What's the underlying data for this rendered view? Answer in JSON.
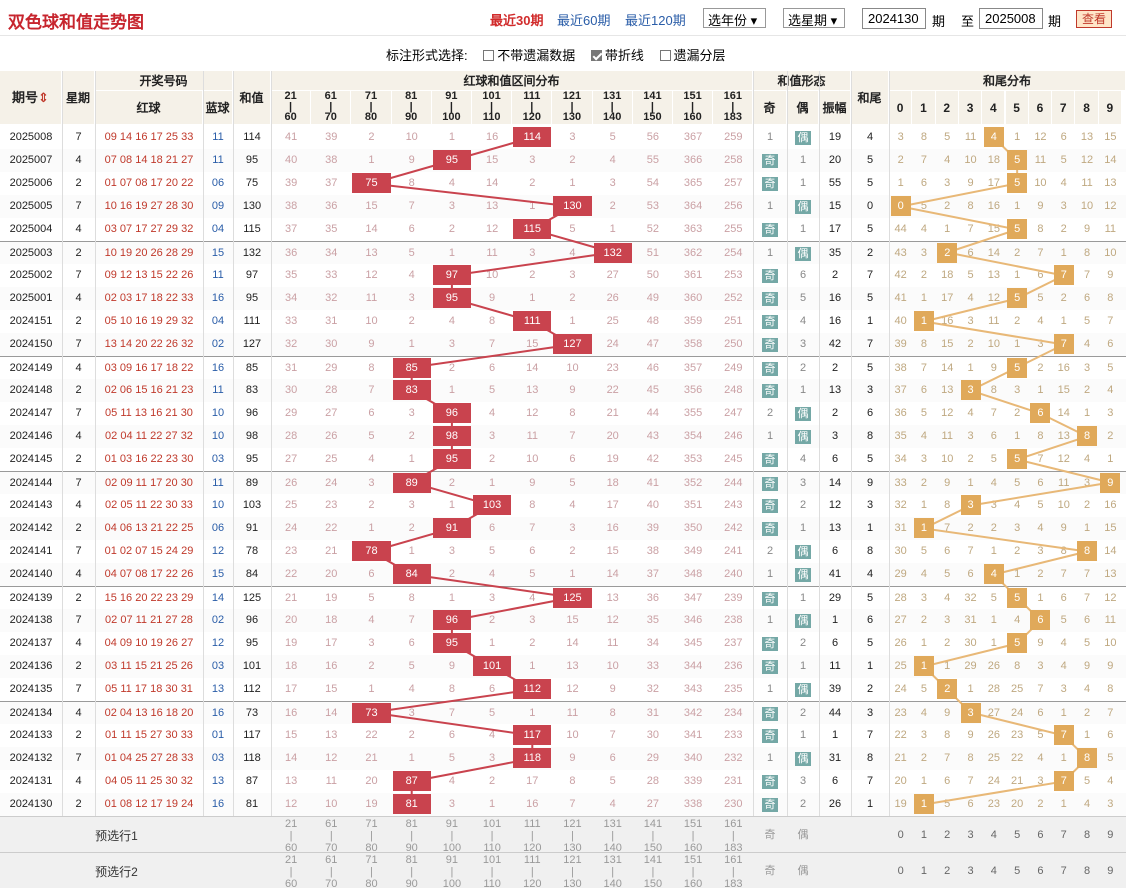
{
  "page": {
    "title": "双色球和值走势图",
    "recent": [
      "最近30期",
      "最近60期",
      "最近120期"
    ],
    "select_year": "选年份",
    "select_period": "选星期",
    "from_value": "2024130",
    "to_value": "2025008",
    "qi": "期",
    "zhi": "至",
    "query_button": "查看",
    "options_label": "标注形式选择:",
    "options": [
      {
        "label": "不带遗漏数据",
        "checked": false
      },
      {
        "label": "带折线",
        "checked": true
      },
      {
        "label": "遗漏分层",
        "checked": false
      }
    ]
  },
  "headers": {
    "period": "期号",
    "weekday": "星期",
    "draw": "开奖号码",
    "red": "红球",
    "blue": "蓝球",
    "sum": "和值",
    "dist": "红球和值区间分布",
    "form": "和值形态",
    "tail": "和尾",
    "tail_dist": "和尾分布",
    "odd": "奇",
    "even": "偶",
    "amp": "振幅",
    "ranges": [
      [
        "21",
        "60"
      ],
      [
        "61",
        "70"
      ],
      [
        "71",
        "80"
      ],
      [
        "81",
        "90"
      ],
      [
        "91",
        "100"
      ],
      [
        "101",
        "110"
      ],
      [
        "111",
        "120"
      ],
      [
        "121",
        "130"
      ],
      [
        "131",
        "140"
      ],
      [
        "141",
        "150"
      ],
      [
        "151",
        "160"
      ],
      [
        "161",
        "183"
      ]
    ],
    "tails": [
      "0",
      "1",
      "2",
      "3",
      "4",
      "5",
      "6",
      "7",
      "8",
      "9"
    ]
  },
  "rows": [
    {
      "period": "2025008",
      "week": "7",
      "red": "09 14 16 17 25 33",
      "blue": "11",
      "sum": "114",
      "dist": [
        "41",
        "39",
        "2",
        "10",
        "1",
        "16",
        "114",
        "3",
        "5",
        "56",
        "367",
        "259"
      ],
      "odd": "1",
      "even": "偶",
      "amp": "19",
      "tail": "4",
      "tails": [
        "3",
        "8",
        "5",
        "11",
        "4",
        "1",
        "12",
        "6",
        "13",
        "15"
      ]
    },
    {
      "period": "2025007",
      "week": "4",
      "red": "07 08 14 18 21 27",
      "blue": "11",
      "sum": "95",
      "dist": [
        "40",
        "38",
        "1",
        "9",
        "95",
        "15",
        "3",
        "2",
        "4",
        "55",
        "366",
        "258"
      ],
      "odd": "奇",
      "even": "1",
      "amp": "20",
      "tail": "5",
      "tails": [
        "2",
        "7",
        "4",
        "10",
        "18",
        "5",
        "11",
        "5",
        "12",
        "14"
      ]
    },
    {
      "period": "2025006",
      "week": "2",
      "red": "01 07 08 17 20 22",
      "blue": "06",
      "sum": "75",
      "dist": [
        "39",
        "37",
        "75",
        "8",
        "4",
        "14",
        "2",
        "1",
        "3",
        "54",
        "365",
        "257"
      ],
      "odd": "奇",
      "even": "1",
      "amp": "55",
      "tail": "5",
      "tails": [
        "1",
        "6",
        "3",
        "9",
        "17",
        "5",
        "10",
        "4",
        "11",
        "13"
      ]
    },
    {
      "period": "2025005",
      "week": "7",
      "red": "10 16 19 27 28 30",
      "blue": "09",
      "sum": "130",
      "dist": [
        "38",
        "36",
        "15",
        "7",
        "3",
        "13",
        "1",
        "130",
        "2",
        "53",
        "364",
        "256"
      ],
      "odd": "1",
      "even": "偶",
      "amp": "15",
      "tail": "0",
      "tails": [
        "0",
        "5",
        "2",
        "8",
        "16",
        "1",
        "9",
        "3",
        "10",
        "12"
      ]
    },
    {
      "period": "2025004",
      "week": "4",
      "red": "03 07 17 27 29 32",
      "blue": "04",
      "sum": "115",
      "dist": [
        "37",
        "35",
        "14",
        "6",
        "2",
        "12",
        "115",
        "5",
        "1",
        "52",
        "363",
        "255"
      ],
      "odd": "奇",
      "even": "1",
      "amp": "17",
      "tail": "5",
      "tails": [
        "44",
        "4",
        "1",
        "7",
        "15",
        "5",
        "8",
        "2",
        "9",
        "11"
      ]
    },
    {
      "period": "2025003",
      "week": "2",
      "red": "10 19 20 26 28 29",
      "blue": "15",
      "sum": "132",
      "dist": [
        "36",
        "34",
        "13",
        "5",
        "1",
        "11",
        "3",
        "4",
        "132",
        "51",
        "362",
        "254"
      ],
      "odd": "1",
      "even": "偶",
      "amp": "35",
      "tail": "2",
      "tails": [
        "43",
        "3",
        "2",
        "6",
        "14",
        "2",
        "7",
        "1",
        "8",
        "10"
      ]
    },
    {
      "period": "2025002",
      "week": "7",
      "red": "09 12 13 15 22 26",
      "blue": "11",
      "sum": "97",
      "dist": [
        "35",
        "33",
        "12",
        "4",
        "97",
        "10",
        "2",
        "3",
        "27",
        "50",
        "361",
        "253"
      ],
      "odd": "奇",
      "even": "6",
      "amp": "2",
      "tail": "7",
      "tails": [
        "42",
        "2",
        "18",
        "5",
        "13",
        "1",
        "6",
        "7",
        "7",
        "9"
      ]
    },
    {
      "period": "2025001",
      "week": "4",
      "red": "02 03 17 18 22 33",
      "blue": "16",
      "sum": "95",
      "dist": [
        "34",
        "32",
        "11",
        "3",
        "95",
        "9",
        "1",
        "2",
        "26",
        "49",
        "360",
        "252"
      ],
      "odd": "奇",
      "even": "5",
      "amp": "16",
      "tail": "5",
      "tails": [
        "41",
        "1",
        "17",
        "4",
        "12",
        "5",
        "5",
        "2",
        "6",
        "8"
      ]
    },
    {
      "period": "2024151",
      "week": "2",
      "red": "05 10 16 19 29 32",
      "blue": "04",
      "sum": "111",
      "dist": [
        "33",
        "31",
        "10",
        "2",
        "4",
        "8",
        "111",
        "1",
        "25",
        "48",
        "359",
        "251"
      ],
      "odd": "奇",
      "even": "4",
      "amp": "16",
      "tail": "1",
      "tails": [
        "40",
        "1",
        "16",
        "3",
        "11",
        "2",
        "4",
        "1",
        "5",
        "7"
      ]
    },
    {
      "period": "2024150",
      "week": "7",
      "red": "13 14 20 22 26 32",
      "blue": "02",
      "sum": "127",
      "dist": [
        "32",
        "30",
        "9",
        "1",
        "3",
        "7",
        "15",
        "127",
        "24",
        "47",
        "358",
        "250"
      ],
      "odd": "奇",
      "even": "3",
      "amp": "42",
      "tail": "7",
      "tails": [
        "39",
        "8",
        "15",
        "2",
        "10",
        "1",
        "3",
        "7",
        "4",
        "6"
      ]
    },
    {
      "period": "2024149",
      "week": "4",
      "red": "03 09 16 17 18 22",
      "blue": "16",
      "sum": "85",
      "dist": [
        "31",
        "29",
        "8",
        "85",
        "2",
        "6",
        "14",
        "10",
        "23",
        "46",
        "357",
        "249"
      ],
      "odd": "奇",
      "even": "2",
      "amp": "2",
      "tail": "5",
      "tails": [
        "38",
        "7",
        "14",
        "1",
        "9",
        "5",
        "2",
        "16",
        "3",
        "5"
      ]
    },
    {
      "period": "2024148",
      "week": "2",
      "red": "02 06 15 16 21 23",
      "blue": "11",
      "sum": "83",
      "dist": [
        "30",
        "28",
        "7",
        "83",
        "1",
        "5",
        "13",
        "9",
        "22",
        "45",
        "356",
        "248"
      ],
      "odd": "奇",
      "even": "1",
      "amp": "13",
      "tail": "3",
      "tails": [
        "37",
        "6",
        "13",
        "3",
        "8",
        "3",
        "1",
        "15",
        "2",
        "4"
      ]
    },
    {
      "period": "2024147",
      "week": "7",
      "red": "05 11 13 16 21 30",
      "blue": "10",
      "sum": "96",
      "dist": [
        "29",
        "27",
        "6",
        "3",
        "96",
        "4",
        "12",
        "8",
        "21",
        "44",
        "355",
        "247"
      ],
      "odd": "2",
      "even": "偶",
      "amp": "2",
      "tail": "6",
      "tails": [
        "36",
        "5",
        "12",
        "4",
        "7",
        "2",
        "6",
        "14",
        "1",
        "3"
      ]
    },
    {
      "period": "2024146",
      "week": "4",
      "red": "02 04 11 22 27 32",
      "blue": "10",
      "sum": "98",
      "dist": [
        "28",
        "26",
        "5",
        "2",
        "98",
        "3",
        "11",
        "7",
        "20",
        "43",
        "354",
        "246"
      ],
      "odd": "1",
      "even": "偶",
      "amp": "3",
      "tail": "8",
      "tails": [
        "35",
        "4",
        "11",
        "3",
        "6",
        "1",
        "8",
        "13",
        "8",
        "2"
      ]
    },
    {
      "period": "2024145",
      "week": "2",
      "red": "01 03 16 22 23 30",
      "blue": "03",
      "sum": "95",
      "dist": [
        "27",
        "25",
        "4",
        "1",
        "95",
        "2",
        "10",
        "6",
        "19",
        "42",
        "353",
        "245"
      ],
      "odd": "奇",
      "even": "4",
      "amp": "6",
      "tail": "5",
      "tails": [
        "34",
        "3",
        "10",
        "2",
        "5",
        "5",
        "7",
        "12",
        "4",
        "1"
      ]
    },
    {
      "period": "2024144",
      "week": "7",
      "red": "02 09 11 17 20 30",
      "blue": "11",
      "sum": "89",
      "dist": [
        "26",
        "24",
        "3",
        "89",
        "2",
        "1",
        "9",
        "5",
        "18",
        "41",
        "352",
        "244"
      ],
      "odd": "奇",
      "even": "3",
      "amp": "14",
      "tail": "9",
      "tails": [
        "33",
        "2",
        "9",
        "1",
        "4",
        "5",
        "6",
        "11",
        "3",
        "9"
      ]
    },
    {
      "period": "2024143",
      "week": "4",
      "red": "02 05 11 22 30 33",
      "blue": "10",
      "sum": "103",
      "dist": [
        "25",
        "23",
        "2",
        "3",
        "1",
        "103",
        "8",
        "4",
        "17",
        "40",
        "351",
        "243"
      ],
      "odd": "奇",
      "even": "2",
      "amp": "12",
      "tail": "3",
      "tails": [
        "32",
        "1",
        "8",
        "3",
        "3",
        "4",
        "5",
        "10",
        "2",
        "16"
      ]
    },
    {
      "period": "2024142",
      "week": "2",
      "red": "04 06 13 21 22 25",
      "blue": "06",
      "sum": "91",
      "dist": [
        "24",
        "22",
        "1",
        "2",
        "91",
        "6",
        "7",
        "3",
        "16",
        "39",
        "350",
        "242"
      ],
      "odd": "奇",
      "even": "1",
      "amp": "13",
      "tail": "1",
      "tails": [
        "31",
        "1",
        "7",
        "2",
        "2",
        "3",
        "4",
        "9",
        "1",
        "15"
      ]
    },
    {
      "period": "2024141",
      "week": "7",
      "red": "01 02 07 15 24 29",
      "blue": "12",
      "sum": "78",
      "dist": [
        "23",
        "21",
        "78",
        "1",
        "3",
        "5",
        "6",
        "2",
        "15",
        "38",
        "349",
        "241"
      ],
      "odd": "2",
      "even": "偶",
      "amp": "6",
      "tail": "8",
      "tails": [
        "30",
        "5",
        "6",
        "7",
        "1",
        "2",
        "3",
        "8",
        "8",
        "14"
      ]
    },
    {
      "period": "2024140",
      "week": "4",
      "red": "04 07 08 17 22 26",
      "blue": "15",
      "sum": "84",
      "dist": [
        "22",
        "20",
        "6",
        "84",
        "2",
        "4",
        "5",
        "1",
        "14",
        "37",
        "348",
        "240"
      ],
      "odd": "1",
      "even": "偶",
      "amp": "41",
      "tail": "4",
      "tails": [
        "29",
        "4",
        "5",
        "6",
        "4",
        "1",
        "2",
        "7",
        "7",
        "13"
      ]
    },
    {
      "period": "2024139",
      "week": "2",
      "red": "15 16 20 22 23 29",
      "blue": "14",
      "sum": "125",
      "dist": [
        "21",
        "19",
        "5",
        "8",
        "1",
        "3",
        "4",
        "125",
        "13",
        "36",
        "347",
        "239"
      ],
      "odd": "奇",
      "even": "1",
      "amp": "29",
      "tail": "5",
      "tails": [
        "28",
        "3",
        "4",
        "32",
        "5",
        "5",
        "1",
        "6",
        "7",
        "12"
      ]
    },
    {
      "period": "2024138",
      "week": "7",
      "red": "02 07 11 21 27 28",
      "blue": "02",
      "sum": "96",
      "dist": [
        "20",
        "18",
        "4",
        "7",
        "96",
        "2",
        "3",
        "15",
        "12",
        "35",
        "346",
        "238"
      ],
      "odd": "1",
      "even": "偶",
      "amp": "1",
      "tail": "6",
      "tails": [
        "27",
        "2",
        "3",
        "31",
        "1",
        "4",
        "6",
        "5",
        "6",
        "11"
      ]
    },
    {
      "period": "2024137",
      "week": "4",
      "red": "04 09 10 19 26 27",
      "blue": "12",
      "sum": "95",
      "dist": [
        "19",
        "17",
        "3",
        "6",
        "95",
        "1",
        "2",
        "14",
        "11",
        "34",
        "345",
        "237"
      ],
      "odd": "奇",
      "even": "2",
      "amp": "6",
      "tail": "5",
      "tails": [
        "26",
        "1",
        "2",
        "30",
        "1",
        "5",
        "9",
        "4",
        "5",
        "10"
      ]
    },
    {
      "period": "2024136",
      "week": "2",
      "red": "03 11 15 21 25 26",
      "blue": "03",
      "sum": "101",
      "dist": [
        "18",
        "16",
        "2",
        "5",
        "9",
        "101",
        "1",
        "13",
        "10",
        "33",
        "344",
        "236"
      ],
      "odd": "奇",
      "even": "1",
      "amp": "11",
      "tail": "1",
      "tails": [
        "25",
        "1",
        "1",
        "29",
        "26",
        "8",
        "3",
        "4",
        "9",
        "9"
      ]
    },
    {
      "period": "2024135",
      "week": "7",
      "red": "05 11 17 18 30 31",
      "blue": "13",
      "sum": "112",
      "dist": [
        "17",
        "15",
        "1",
        "4",
        "8",
        "6",
        "112",
        "12",
        "9",
        "32",
        "343",
        "235"
      ],
      "odd": "1",
      "even": "偶",
      "amp": "39",
      "tail": "2",
      "tails": [
        "24",
        "5",
        "2",
        "1",
        "28",
        "25",
        "7",
        "3",
        "4",
        "8"
      ]
    },
    {
      "period": "2024134",
      "week": "4",
      "red": "02 04 13 16 18 20",
      "blue": "16",
      "sum": "73",
      "dist": [
        "16",
        "14",
        "73",
        "3",
        "7",
        "5",
        "1",
        "11",
        "8",
        "31",
        "342",
        "234"
      ],
      "odd": "奇",
      "even": "2",
      "amp": "44",
      "tail": "3",
      "tails": [
        "23",
        "4",
        "9",
        "3",
        "27",
        "24",
        "6",
        "1",
        "2",
        "7"
      ]
    },
    {
      "period": "2024133",
      "week": "2",
      "red": "01 11 15 27 30 33",
      "blue": "01",
      "sum": "117",
      "dist": [
        "15",
        "13",
        "22",
        "2",
        "6",
        "4",
        "117",
        "10",
        "7",
        "30",
        "341",
        "233"
      ],
      "odd": "奇",
      "even": "1",
      "amp": "1",
      "tail": "7",
      "tails": [
        "22",
        "3",
        "8",
        "9",
        "26",
        "23",
        "5",
        "7",
        "1",
        "6"
      ]
    },
    {
      "period": "2024132",
      "week": "7",
      "red": "01 04 25 27 28 33",
      "blue": "03",
      "sum": "118",
      "dist": [
        "14",
        "12",
        "21",
        "1",
        "5",
        "3",
        "118",
        "9",
        "6",
        "29",
        "340",
        "232"
      ],
      "odd": "1",
      "even": "偶",
      "amp": "31",
      "tail": "8",
      "tails": [
        "21",
        "2",
        "7",
        "8",
        "25",
        "22",
        "4",
        "1",
        "8",
        "5"
      ]
    },
    {
      "period": "2024131",
      "week": "4",
      "red": "04 05 11 25 30 32",
      "blue": "13",
      "sum": "87",
      "dist": [
        "13",
        "11",
        "20",
        "87",
        "4",
        "2",
        "17",
        "8",
        "5",
        "28",
        "339",
        "231"
      ],
      "odd": "奇",
      "even": "3",
      "amp": "6",
      "tail": "7",
      "tails": [
        "20",
        "1",
        "6",
        "7",
        "24",
        "21",
        "3",
        "7",
        "5",
        "4"
      ]
    },
    {
      "period": "2024130",
      "week": "2",
      "red": "01 08 12 17 19 24",
      "blue": "16",
      "sum": "81",
      "dist": [
        "12",
        "10",
        "19",
        "81",
        "3",
        "1",
        "16",
        "7",
        "4",
        "27",
        "338",
        "230"
      ],
      "odd": "奇",
      "even": "2",
      "amp": "26",
      "tail": "1",
      "tails": [
        "19",
        "1",
        "5",
        "6",
        "23",
        "20",
        "2",
        "1",
        "4",
        "3"
      ]
    }
  ],
  "hit_col": [
    6,
    4,
    2,
    7,
    6,
    8,
    4,
    4,
    6,
    7,
    3,
    3,
    4,
    4,
    4,
    3,
    5,
    4,
    2,
    3,
    7,
    4,
    4,
    5,
    6,
    2,
    6,
    6,
    3,
    3
  ],
  "footer": {
    "pre1": "预选行1",
    "pre2": "预选行2"
  }
}
